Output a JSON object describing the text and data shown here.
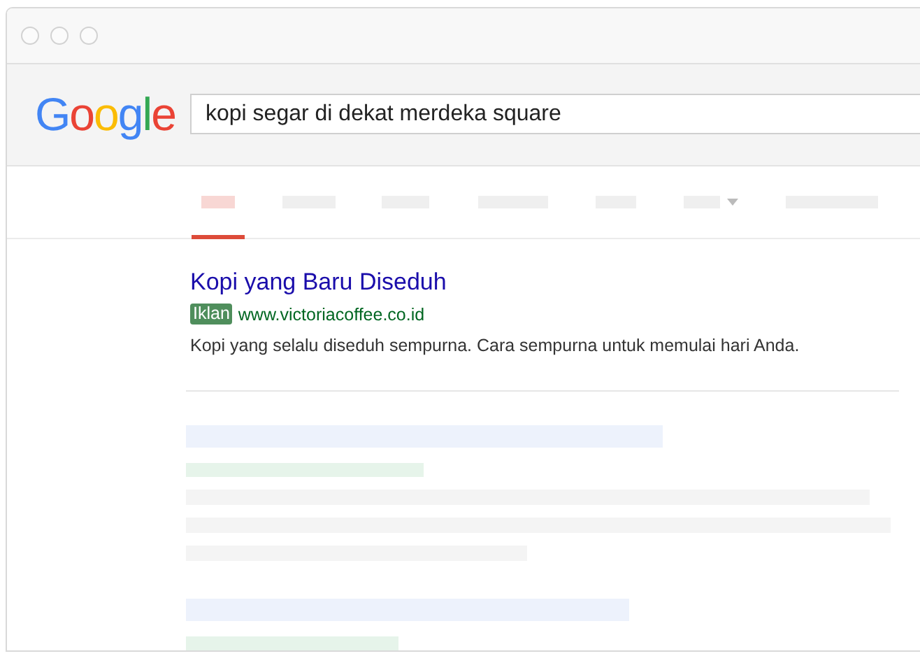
{
  "window": {
    "controls": [
      {
        "kind": "dot"
      },
      {
        "kind": "dot"
      },
      {
        "kind": "dot"
      }
    ]
  },
  "logo": "Google",
  "search": {
    "value": "kopi segar di dekat merdeka square"
  },
  "tabs": [
    {
      "selected": true,
      "dropdown": false
    },
    {
      "selected": false,
      "dropdown": false
    },
    {
      "selected": false,
      "dropdown": false
    },
    {
      "selected": false,
      "dropdown": false
    },
    {
      "selected": false,
      "dropdown": false
    },
    {
      "selected": false,
      "dropdown": true
    },
    {
      "selected": false,
      "dropdown": false
    }
  ],
  "ad": {
    "title": "Kopi yang Baru Diseduh",
    "badge": "Iklan",
    "url": "www.victoriacoffee.co.id",
    "description": "Kopi yang selalu diseduh sempurna. Cara sempurna untuk memulai hari Anda."
  },
  "results": [
    {
      "kind": "skeleton"
    },
    {
      "kind": "skeleton_short"
    }
  ]
}
